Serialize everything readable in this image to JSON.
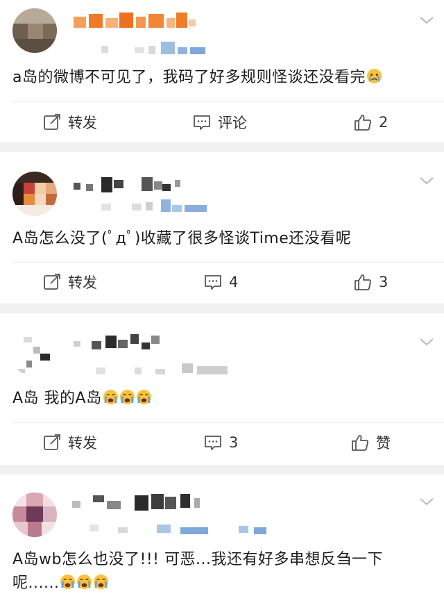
{
  "posts": [
    {
      "text": "a岛的微博不可见了，我码了好多规则怪谈还没看完",
      "emoji_count": 1,
      "repost_label": "转发",
      "comment_label": "评论",
      "like_label": "2"
    },
    {
      "text": "A岛怎么没了(ﾟдﾟ)收藏了很多怪谈Time还没看呢",
      "emoji_count": 0,
      "repost_label": "转发",
      "comment_label": "4",
      "like_label": "3"
    },
    {
      "text": "A岛 我的A岛",
      "emoji_count": 3,
      "repost_label": "转发",
      "comment_label": "3",
      "like_label": "赞"
    },
    {
      "text_line1": "A岛wb怎么也没了!!! 可恶...我还有好多串想反刍一下",
      "text_line2": "呢......",
      "emoji_count": 3
    }
  ],
  "icons": {
    "repost": "repost-icon",
    "comment": "comment-icon",
    "like": "thumbs-up-icon",
    "expand": "chevron-down-icon",
    "crying": "crying-face-icon"
  },
  "colors": {
    "background": "#f1f1f1",
    "card": "#ffffff",
    "text": "#1c1c1c",
    "muted": "#333333",
    "accent_blue": "#5b8dc9"
  }
}
